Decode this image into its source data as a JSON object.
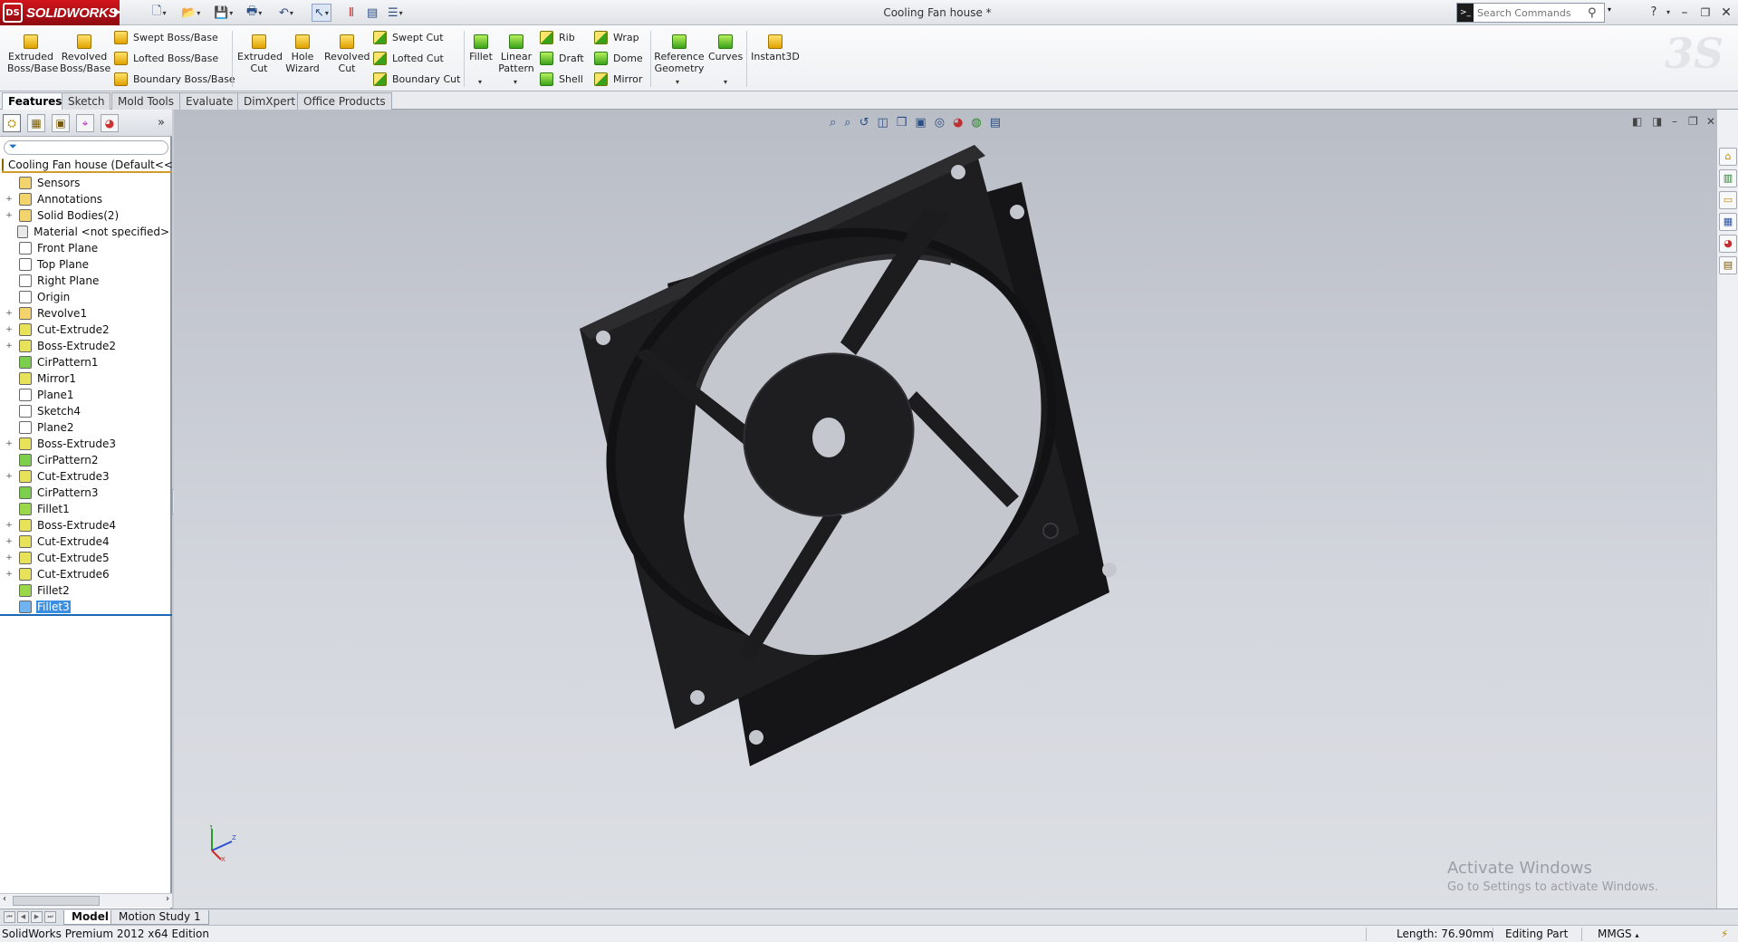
{
  "app": {
    "name": "SOLIDWORKS",
    "logo_mark": "DS",
    "document_title": "Cooling Fan house *"
  },
  "search": {
    "placeholder": "Search Commands"
  },
  "ribbon": {
    "big_buttons": [
      {
        "label": "Extruded\nBoss/Base",
        "icon": "extruded-boss-icon"
      },
      {
        "label": "Revolved\nBoss/Base",
        "icon": "revolved-boss-icon"
      },
      {
        "label": "Extruded\nCut",
        "icon": "extruded-cut-icon"
      },
      {
        "label": "Hole\nWizard",
        "icon": "hole-wizard-icon"
      },
      {
        "label": "Revolved\nCut",
        "icon": "revolved-cut-icon"
      },
      {
        "label": "Fillet",
        "icon": "fillet-icon"
      },
      {
        "label": "Linear\nPattern",
        "icon": "linear-pattern-icon"
      },
      {
        "label": "Reference\nGeometry",
        "icon": "reference-geometry-icon"
      },
      {
        "label": "Curves",
        "icon": "curves-icon"
      },
      {
        "label": "Instant3D",
        "icon": "instant3d-icon"
      }
    ],
    "small_buttons": [
      {
        "label": "Swept Boss/Base"
      },
      {
        "label": "Lofted Boss/Base"
      },
      {
        "label": "Boundary Boss/Base"
      },
      {
        "label": "Swept Cut"
      },
      {
        "label": "Lofted Cut"
      },
      {
        "label": "Boundary Cut"
      },
      {
        "label": "Rib"
      },
      {
        "label": "Draft"
      },
      {
        "label": "Shell"
      },
      {
        "label": "Wrap"
      },
      {
        "label": "Dome"
      },
      {
        "label": "Mirror"
      }
    ]
  },
  "tabs": [
    "Features",
    "Sketch",
    "Mold Tools",
    "Evaluate",
    "DimXpert",
    "Office Products"
  ],
  "feature_tree": {
    "root": "Cooling Fan house  (Default<<D",
    "items": [
      {
        "label": "Sensors",
        "expand": "",
        "icon": "sensor-icon",
        "color": "#f3d36b"
      },
      {
        "label": "Annotations",
        "expand": "+",
        "icon": "annotations-icon",
        "color": "#f3d36b"
      },
      {
        "label": "Solid Bodies(2)",
        "expand": "+",
        "icon": "solid-bodies-icon",
        "color": "#f3d36b"
      },
      {
        "label": "Material <not specified>",
        "expand": "",
        "icon": "material-icon",
        "color": "#e9e9e9"
      },
      {
        "label": "Front Plane",
        "expand": "",
        "icon": "plane-icon",
        "color": "#ffffff"
      },
      {
        "label": "Top Plane",
        "expand": "",
        "icon": "plane-icon",
        "color": "#ffffff"
      },
      {
        "label": "Right Plane",
        "expand": "",
        "icon": "plane-icon",
        "color": "#ffffff"
      },
      {
        "label": "Origin",
        "expand": "",
        "icon": "origin-icon",
        "color": "#ffffff"
      },
      {
        "label": "Revolve1",
        "expand": "+",
        "icon": "revolve-icon",
        "color": "#f3d36b"
      },
      {
        "label": "Cut-Extrude2",
        "expand": "+",
        "icon": "cut-extrude-icon",
        "color": "#e8e15a"
      },
      {
        "label": "Boss-Extrude2",
        "expand": "+",
        "icon": "boss-extrude-icon",
        "color": "#e8e15a"
      },
      {
        "label": "CirPattern1",
        "expand": "",
        "icon": "circular-pattern-icon",
        "color": "#7ccf4a"
      },
      {
        "label": "Mirror1",
        "expand": "",
        "icon": "mirror-icon",
        "color": "#e8e15a"
      },
      {
        "label": "Plane1",
        "expand": "",
        "icon": "plane-icon",
        "color": "#ffffff"
      },
      {
        "label": "Sketch4",
        "expand": "",
        "icon": "sketch-icon",
        "color": "#ffffff"
      },
      {
        "label": "Plane2",
        "expand": "",
        "icon": "plane-icon",
        "color": "#ffffff"
      },
      {
        "label": "Boss-Extrude3",
        "expand": "+",
        "icon": "boss-extrude-icon",
        "color": "#e8e15a"
      },
      {
        "label": "CirPattern2",
        "expand": "",
        "icon": "circular-pattern-icon",
        "color": "#7ccf4a"
      },
      {
        "label": "Cut-Extrude3",
        "expand": "+",
        "icon": "cut-extrude-icon",
        "color": "#e8e15a"
      },
      {
        "label": "CirPattern3",
        "expand": "",
        "icon": "circular-pattern-icon",
        "color": "#7ccf4a"
      },
      {
        "label": "Fillet1",
        "expand": "",
        "icon": "fillet-icon",
        "color": "#9ad84a"
      },
      {
        "label": "Boss-Extrude4",
        "expand": "+",
        "icon": "boss-extrude-icon",
        "color": "#e8e15a"
      },
      {
        "label": "Cut-Extrude4",
        "expand": "+",
        "icon": "cut-extrude-icon",
        "color": "#e8e15a"
      },
      {
        "label": "Cut-Extrude5",
        "expand": "+",
        "icon": "cut-extrude-icon",
        "color": "#e8e15a"
      },
      {
        "label": "Cut-Extrude6",
        "expand": "+",
        "icon": "cut-extrude-icon",
        "color": "#e8e15a"
      },
      {
        "label": "Fillet2",
        "expand": "",
        "icon": "fillet-icon",
        "color": "#9ad84a"
      },
      {
        "label": "Fillet3",
        "expand": "",
        "icon": "fillet-icon",
        "color": "#6fb4f0",
        "selected": true
      }
    ]
  },
  "watermark": {
    "line1": "Activate Windows",
    "line2": "Go to Settings to activate Windows."
  },
  "bottom_tabs": [
    "Model",
    "Motion Study 1"
  ],
  "status": {
    "edition": "SolidWorks Premium 2012 x64 Edition",
    "length": "Length: 76.90mm",
    "mode": "Editing Part",
    "units": "MMGS"
  },
  "colors": {
    "brand_red": "#c8101a",
    "selection_blue": "#3b8fe3",
    "model_black": "#1c1c1e"
  }
}
